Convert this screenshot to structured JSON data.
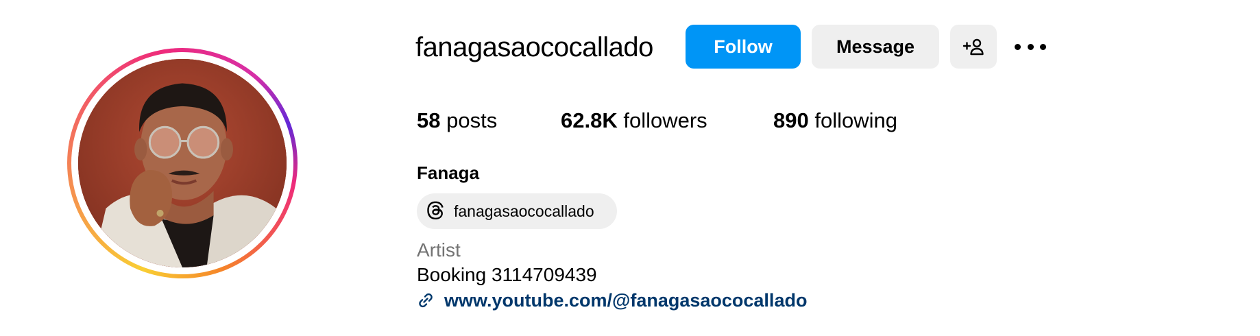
{
  "profile": {
    "username": "fanagasaococallado",
    "full_name": "Fanaga",
    "category": "Artist",
    "bio_line": "Booking 3114709439",
    "link": "www.youtube.com/@fanagasaococallado",
    "threads_handle": "fanagasaococallado"
  },
  "actions": {
    "follow_label": "Follow",
    "message_label": "Message"
  },
  "stats": {
    "posts_count": "58",
    "posts_label": "posts",
    "followers_count": "62.8K",
    "followers_label": "followers",
    "following_count": "890",
    "following_label": "following"
  },
  "colors": {
    "follow_button": "#0095f6",
    "secondary_button": "#efefef",
    "link": "#00376b",
    "category": "#737373"
  },
  "icons": {
    "add_user": "person-plus-icon",
    "more": "more-horizontal-icon",
    "threads": "threads-icon",
    "link": "link-icon"
  }
}
